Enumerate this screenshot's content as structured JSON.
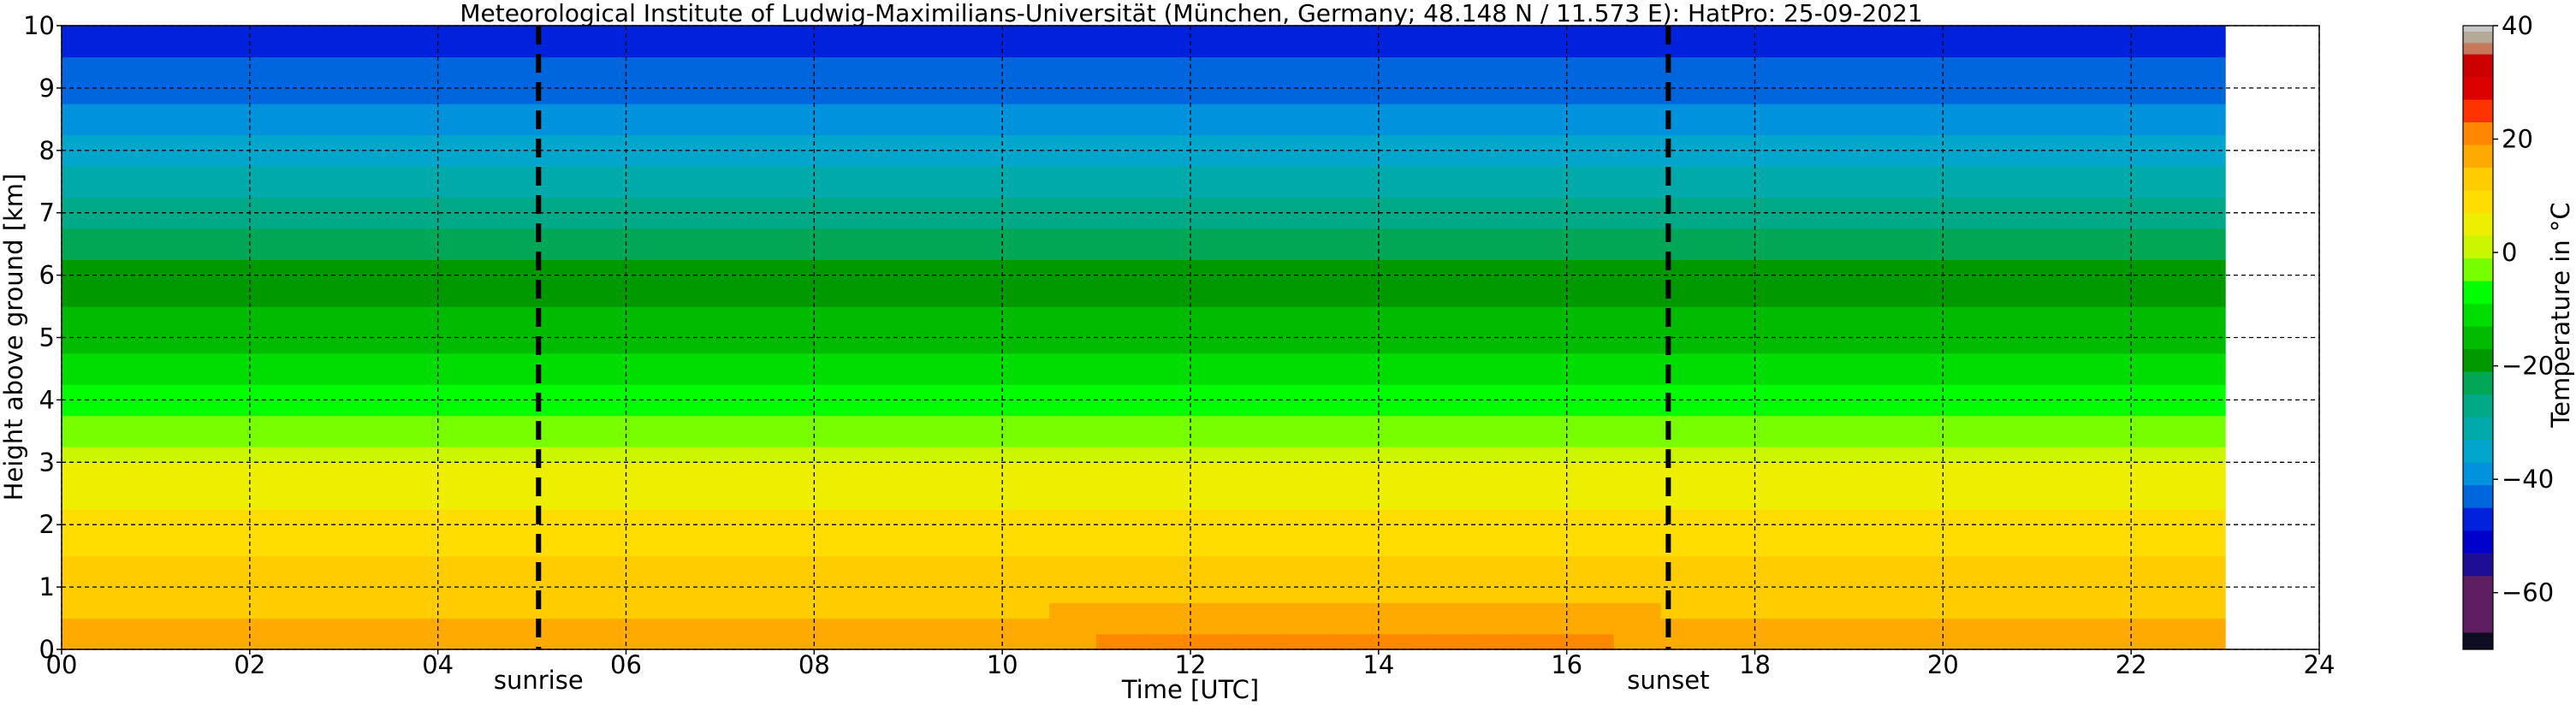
{
  "chart_data": {
    "type": "heatmap",
    "title": "Meteorological Institute of Ludwig-Maximilians-Universität (München, Germany; 48.148 N / 11.573 E):    HatPro: 25-09-2021",
    "xlabel": "Time [UTC]",
    "ylabel": "Height above ground [km]",
    "xlim": [
      0,
      24
    ],
    "ylim": [
      0,
      10
    ],
    "data_time_range_h": [
      0,
      23
    ],
    "x_tick_labels": [
      "00",
      "02",
      "04",
      "06",
      "08",
      "10",
      "12",
      "14",
      "16",
      "18",
      "20",
      "22",
      "24"
    ],
    "y_tick_labels": [
      "0",
      "1",
      "2",
      "3",
      "4",
      "5",
      "6",
      "7",
      "8",
      "9",
      "10"
    ],
    "grid": true,
    "colorbar": {
      "label": "Temperature in °C",
      "range": [
        -70,
        40
      ],
      "tick_labels": [
        "−60",
        "−40",
        "−20",
        "0",
        "20",
        "40"
      ],
      "tick_values": [
        -60,
        -40,
        -20,
        0,
        20,
        40
      ],
      "levels": [
        {
          "from": -70,
          "to": -67,
          "color": "#0c0c22"
        },
        {
          "from": -67,
          "to": -57,
          "color": "#5e1e60"
        },
        {
          "from": -57,
          "to": -53,
          "color": "#1a0f94"
        },
        {
          "from": -53,
          "to": -49,
          "color": "#0000cc"
        },
        {
          "from": -49,
          "to": -45,
          "color": "#0022dd"
        },
        {
          "from": -45,
          "to": -41,
          "color": "#0066dd"
        },
        {
          "from": -41,
          "to": -37,
          "color": "#0092dd"
        },
        {
          "from": -37,
          "to": -33,
          "color": "#00a6cc"
        },
        {
          "from": -33,
          "to": -29,
          "color": "#00aaaa"
        },
        {
          "from": -29,
          "to": -25,
          "color": "#00aa88"
        },
        {
          "from": -25,
          "to": -21,
          "color": "#00a855"
        },
        {
          "from": -21,
          "to": -17,
          "color": "#009900"
        },
        {
          "from": -17,
          "to": -13,
          "color": "#00bb00"
        },
        {
          "from": -13,
          "to": -9,
          "color": "#00dd00"
        },
        {
          "from": -9,
          "to": -5,
          "color": "#00ff00"
        },
        {
          "from": -5,
          "to": -1,
          "color": "#77ff00"
        },
        {
          "from": -1,
          "to": 3,
          "color": "#ccf500"
        },
        {
          "from": 3,
          "to": 7,
          "color": "#eeee00"
        },
        {
          "from": 7,
          "to": 11,
          "color": "#ffdd00"
        },
        {
          "from": 11,
          "to": 15,
          "color": "#ffcc00"
        },
        {
          "from": 15,
          "to": 19,
          "color": "#ffaa00"
        },
        {
          "from": 19,
          "to": 23,
          "color": "#ff8800"
        },
        {
          "from": 23,
          "to": 27,
          "color": "#ff3300"
        },
        {
          "from": 27,
          "to": 31,
          "color": "#dd0000"
        },
        {
          "from": 31,
          "to": 35,
          "color": "#cc0000"
        },
        {
          "from": 35,
          "to": 37,
          "color": "#c8785a"
        },
        {
          "from": 37,
          "to": 39,
          "color": "#b4aa96"
        },
        {
          "from": 39,
          "to": 40,
          "color": "#c8c8c8"
        }
      ]
    },
    "profile_heights_km": [
      0,
      0.5,
      1,
      1.5,
      2,
      2.5,
      3,
      3.5,
      4,
      4.5,
      5,
      5.5,
      6,
      6.5,
      7,
      7.5,
      8,
      8.5,
      9,
      9.5,
      9.8,
      10
    ],
    "profile_temperature_c": [
      17,
      15,
      13,
      11,
      9,
      6,
      3,
      -3,
      -8,
      -11,
      -14,
      -18,
      -20,
      -22,
      -28,
      -32,
      -35,
      -39,
      -42,
      -44,
      -48,
      -50
    ],
    "daytime_surface_anomaly": {
      "peak_time_h": 15,
      "peak_delta_c": 7,
      "start_time_h": 9.5,
      "end_time_h": 17.5,
      "decay_height_km": 0.5
    },
    "events": [
      {
        "label": "sunrise",
        "time_h": 5.07
      },
      {
        "label": "sunset",
        "time_h": 17.08
      }
    ]
  }
}
